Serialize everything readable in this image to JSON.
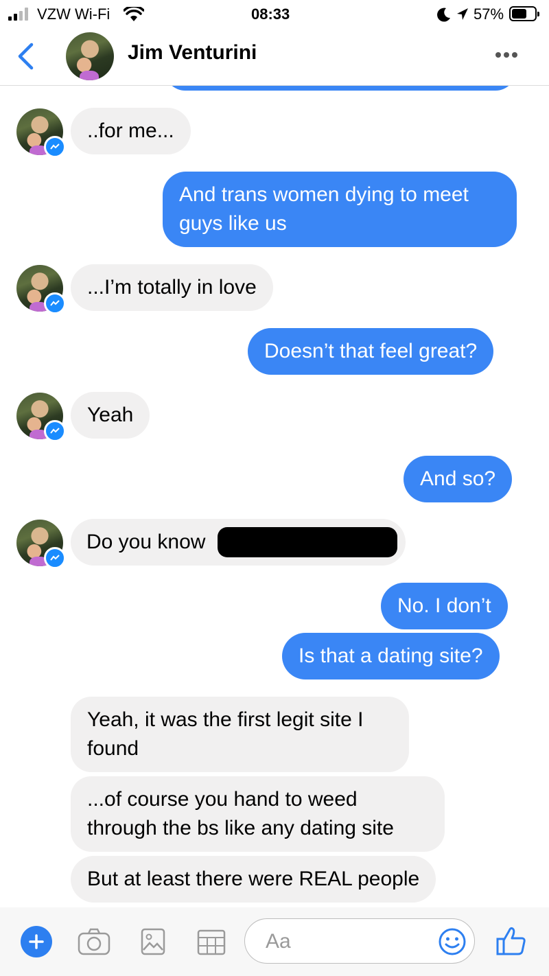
{
  "status_bar": {
    "carrier": "VZW Wi-Fi",
    "time": "08:33",
    "battery": "57%"
  },
  "header": {
    "contact_name": "Jim Venturini",
    "back_icon": "chevron-left-icon",
    "more_icon": "more-horizontal-icon"
  },
  "messages": [
    {
      "side": "in",
      "text": "..for me..."
    },
    {
      "side": "out",
      "text": "And trans women dying to meet guys like us"
    },
    {
      "side": "in",
      "text": "...I’m totally in love"
    },
    {
      "side": "out",
      "text": "Doesn’t that feel great?"
    },
    {
      "side": "in",
      "text": "Yeah"
    },
    {
      "side": "out",
      "text": "And so?"
    },
    {
      "side": "in",
      "text": "Do you know"
    },
    {
      "side": "out",
      "text": "No. I don’t"
    },
    {
      "side": "out",
      "text": "Is that a dating site?"
    },
    {
      "side": "in",
      "text": "Yeah, it was the first legit site I found"
    },
    {
      "side": "in",
      "text": "...of course you hand to weed through the bs like any dating site"
    },
    {
      "side": "in",
      "text": "But at least there were REAL people"
    }
  ],
  "composer": {
    "placeholder": "Aa",
    "icons": [
      "plus-icon",
      "camera-icon",
      "gallery-icon",
      "grid-icon",
      "emoji-icon",
      "thumbs-up-icon"
    ]
  },
  "colors": {
    "accent": "#3a86f5",
    "incoming_bubble": "#f1f0f0",
    "messenger_badge": "#1a8cff"
  }
}
